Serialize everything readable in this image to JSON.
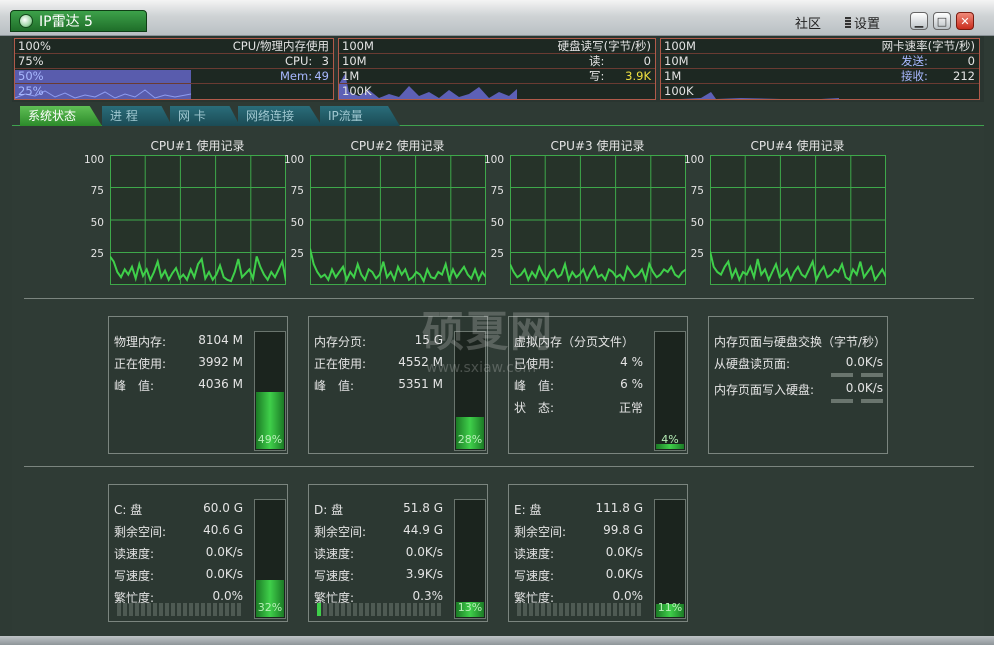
{
  "app": {
    "title": "IP雷达 5",
    "community": "社区",
    "settings": "设置"
  },
  "meters": {
    "cpu": {
      "title": "CPU/物理内存使用",
      "p100": "100%",
      "p75": "75%",
      "p50": "50%",
      "p25": "25%",
      "cpu_label": "CPU:",
      "cpu_value": "3",
      "mem_label": "Mem:",
      "mem_value": "49"
    },
    "disk": {
      "title": "硬盘读写(字节/秒)",
      "s100m": "100M",
      "s10m": "10M",
      "s1m": "1M",
      "s100k": "100K",
      "read_label": "读:",
      "read_value": "0",
      "write_label": "写:",
      "write_value": "3.9K"
    },
    "net": {
      "title": "网卡速率(字节/秒)",
      "s100m": "100M",
      "s10m": "10M",
      "s1m": "1M",
      "s100k": "100K",
      "send_label": "发送:",
      "send_value": "0",
      "recv_label": "接收:",
      "recv_value": "212"
    }
  },
  "tabs": [
    "系统状态",
    "进 程",
    "网 卡",
    "网络连接",
    "IP流量"
  ],
  "cpu_graphs": {
    "ticks": [
      "100",
      "75",
      "50",
      "25"
    ],
    "titles": [
      "CPU#1 使用记录",
      "CPU#2 使用记录",
      "CPU#3 使用记录",
      "CPU#4 使用记录"
    ]
  },
  "memory": {
    "physical": {
      "l1": "物理内存:",
      "v1": "8104 M",
      "l2": "正在使用:",
      "v2": "3992 M",
      "l3": "峰　值:",
      "v3": "4036 M",
      "pct": "49%"
    },
    "paged": {
      "l1": "内存分页:",
      "v1": "15 G",
      "l2": "正在使用:",
      "v2": "4552 M",
      "l3": "峰　值:",
      "v3": "5351 M",
      "pct": "28%"
    },
    "virtual": {
      "title": "虚拟内存（分页文件）",
      "l1": "已使用:",
      "v1": "4 %",
      "l2": "峰　值:",
      "v2": "6 %",
      "l3": "状　态:",
      "v3": "正常",
      "pct": "4%"
    },
    "swap": {
      "title": "内存页面与硬盘交换（字节/秒）",
      "l1": "从硬盘读页面:",
      "v1": "0.0K/s",
      "l2": "内存页面写入硬盘:",
      "v2": "0.0K/s"
    }
  },
  "disks": [
    {
      "name": "C: 盘",
      "size": "60.0 G",
      "free_l": "剩余空间:",
      "free": "40.6 G",
      "read_l": "读速度:",
      "read": "0.0K/s",
      "write_l": "写速度:",
      "write": "0.0K/s",
      "busy_l": "繁忙度:",
      "busy": "0.0%",
      "pct": "32%"
    },
    {
      "name": "D: 盘",
      "size": "51.8 G",
      "free_l": "剩余空间:",
      "free": "44.9 G",
      "read_l": "读速度:",
      "read": "0.0K/s",
      "write_l": "写速度:",
      "write": "3.9K/s",
      "busy_l": "繁忙度:",
      "busy": "0.3%",
      "pct": "13%"
    },
    {
      "name": "E: 盘",
      "size": "111.8 G",
      "free_l": "剩余空间:",
      "free": "99.8 G",
      "read_l": "读速度:",
      "read": "0.0K/s",
      "write_l": "写速度:",
      "write": "0.0K/s",
      "busy_l": "繁忙度:",
      "busy": "0.0%",
      "pct": "11%"
    }
  ],
  "gauge_levels": {
    "physical": 0.49,
    "paged": 0.28,
    "virtual": 0.04,
    "c": 0.32,
    "d": 0.13,
    "e": 0.11
  },
  "colors": {
    "graph_line": "#3fcf4a",
    "grid": "#3ea84a",
    "accent": "#2c8a2a",
    "highlight": "#f0e040"
  },
  "watermark": {
    "main": "硕夏网",
    "sub": "www.sxiaw.com"
  }
}
